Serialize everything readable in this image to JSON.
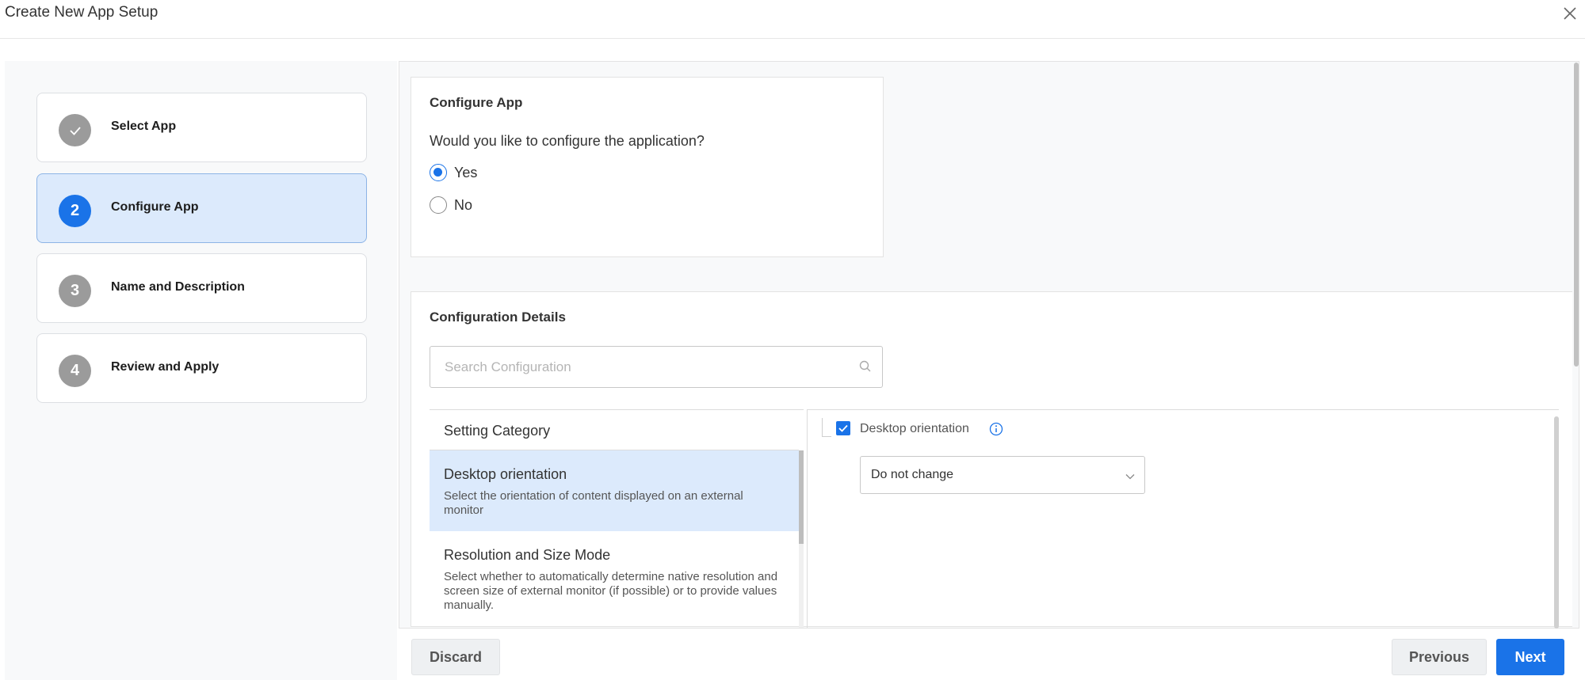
{
  "header": {
    "title": "Create New App Setup"
  },
  "wizard": {
    "steps": [
      {
        "badge": "",
        "label": "Select App",
        "state": "done"
      },
      {
        "badge": "2",
        "label": "Configure App",
        "state": "active"
      },
      {
        "badge": "3",
        "label": "Name and Description",
        "state": "pending"
      },
      {
        "badge": "4",
        "label": "Review and Apply",
        "state": "pending"
      }
    ]
  },
  "configure_app": {
    "title": "Configure App",
    "question": "Would you like to configure the application?",
    "options": [
      {
        "label": "Yes",
        "checked": true
      },
      {
        "label": "No",
        "checked": false
      }
    ]
  },
  "configuration_details": {
    "title": "Configuration Details",
    "search_placeholder": "Search Configuration",
    "category_header": "Setting Category",
    "categories": [
      {
        "name": "Desktop orientation",
        "desc": "Select the orientation of content displayed on an external monitor",
        "selected": true
      },
      {
        "name": "Resolution and Size Mode",
        "desc": "Select whether to automatically determine native resolution and screen size of external monitor (if possible) or to provide values manually.",
        "selected": false
      }
    ],
    "detail": {
      "label": "Desktop orientation",
      "checked": true,
      "dropdown_value": "Do not change"
    }
  },
  "footer": {
    "discard": "Discard",
    "previous": "Previous",
    "next": "Next"
  },
  "colors": {
    "accent": "#1a73e8",
    "active_step_bg": "#dceafc",
    "pending_badge": "#9b9b9b"
  }
}
